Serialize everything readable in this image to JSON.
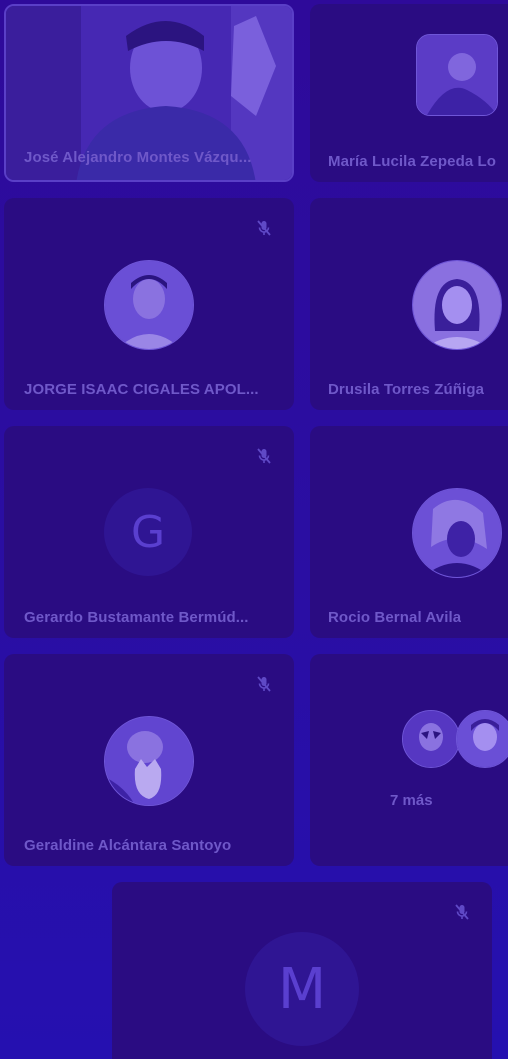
{
  "participants": [
    {
      "name": "José Alejandro Montes Vázqu...",
      "muted": false,
      "tile": "video"
    },
    {
      "name": "María Lucila Zepeda Lo",
      "muted": false,
      "tile": "photo"
    },
    {
      "name": "JORGE ISAAC CIGALES APOL...",
      "muted": true,
      "tile": "photo"
    },
    {
      "name": "Drusila Torres Zúñiga",
      "muted": false,
      "tile": "photo"
    },
    {
      "name": "Gerardo Bustamante Bermúd...",
      "muted": true,
      "tile": "letter",
      "initial": "G"
    },
    {
      "name": "Rocio Bernal Avila",
      "muted": false,
      "tile": "photo"
    },
    {
      "name": "Geraldine Alcántara Santoyo",
      "muted": true,
      "tile": "photo"
    }
  ],
  "overflow": {
    "label": "7 más"
  },
  "self_tile": {
    "initial": "M",
    "muted": true
  },
  "colors": {
    "background": "#2a0d9a",
    "tile": "#2a0c82",
    "text": "#6f58c9",
    "icon": "#5f49c6"
  },
  "icons": {
    "mute": "mic-off-icon"
  }
}
